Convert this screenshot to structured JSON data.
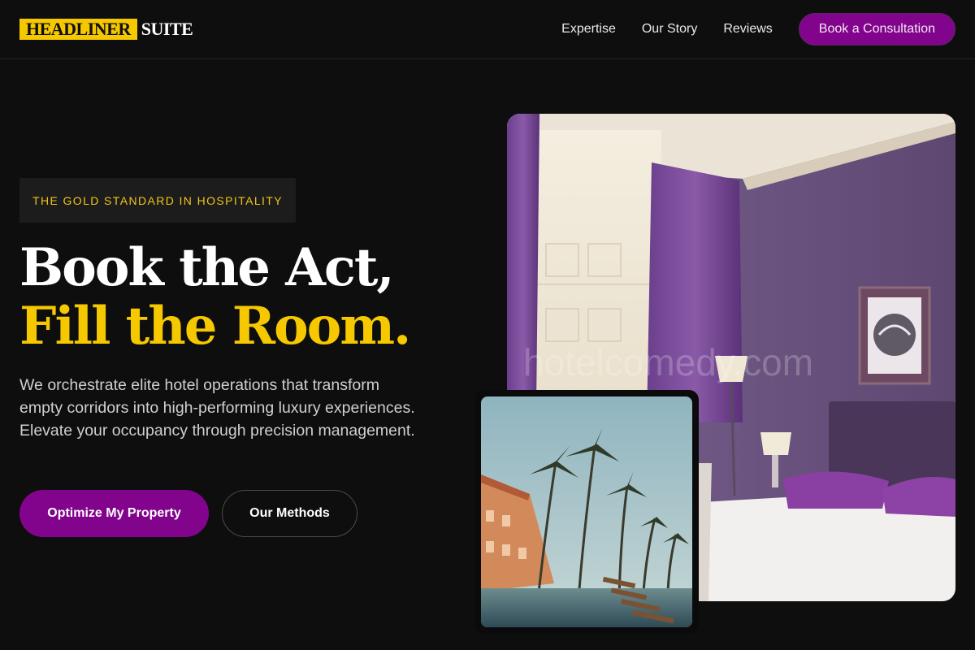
{
  "brand": {
    "part1": "HEADLINER",
    "part2": "SUITE",
    "accent": "#f5c800"
  },
  "nav": {
    "links": [
      "Expertise",
      "Our Story",
      "Reviews"
    ],
    "cta": "Book a Consultation"
  },
  "hero": {
    "eyebrow": "THE GOLD STANDARD IN HOSPITALITY",
    "title_line1": "Book the Act,",
    "title_line2": "Fill the Room.",
    "description": "We orchestrate elite hotel operations that transform empty corridors into high-performing luxury experiences. Elevate your occupancy through precision management.",
    "primary_button": "Optimize My Property",
    "secondary_button": "Our Methods"
  },
  "images": {
    "room_watermark": "hotelcomedy.com"
  },
  "colors": {
    "background": "#0e0e0e",
    "purple": "#82048c",
    "gold": "#f5c800"
  }
}
